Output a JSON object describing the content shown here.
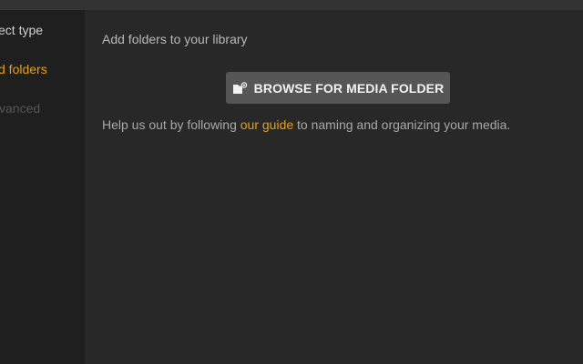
{
  "sidebar": {
    "items": [
      {
        "label": "ect type",
        "state": "normal"
      },
      {
        "label": "d folders",
        "state": "active"
      },
      {
        "label": "vanced",
        "state": "disabled"
      }
    ]
  },
  "main": {
    "heading": "Add folders to your library",
    "browse_button": {
      "label": "BROWSE FOR MEDIA FOLDER",
      "icon": "folder-add-icon"
    },
    "help": {
      "prefix": "Help us out by following ",
      "link": "our guide",
      "suffix": " to naming and organizing your media."
    }
  },
  "colors": {
    "accent": "#e5a00d",
    "background": "#282828",
    "sidebar_background": "#1f1f1f",
    "button_background": "#565656"
  }
}
